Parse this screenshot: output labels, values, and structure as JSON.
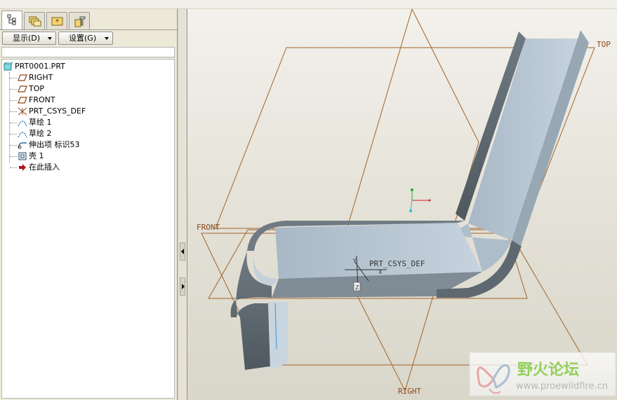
{
  "tabs": [
    {
      "icon": "model-tree-icon",
      "active": true
    },
    {
      "icon": "folder-browser-icon",
      "active": false
    },
    {
      "icon": "favorites-icon",
      "active": false
    },
    {
      "icon": "tools-icon",
      "active": false
    }
  ],
  "toolbar": {
    "show_label": "显示(D)",
    "settings_label": "设置(G)"
  },
  "tree": {
    "root": "PRT0001.PRT",
    "items": [
      {
        "label": "RIGHT",
        "icon": "datum-plane-icon"
      },
      {
        "label": "TOP",
        "icon": "datum-plane-icon"
      },
      {
        "label": "FRONT",
        "icon": "datum-plane-icon"
      },
      {
        "label": "PRT_CSYS_DEF",
        "icon": "coordinate-system-icon"
      },
      {
        "label": "草绘 1",
        "icon": "sketch-icon"
      },
      {
        "label": "草绘 2",
        "icon": "sketch-icon"
      },
      {
        "label": "伸出项 标识53",
        "icon": "sweep-icon"
      },
      {
        "label": "壳 1",
        "icon": "shell-icon"
      },
      {
        "label": "在此插入",
        "icon": "insert-here-arrow-icon"
      }
    ]
  },
  "viewport": {
    "plane_labels": {
      "top": "TOP",
      "front": "FRONT",
      "right": "RIGHT"
    },
    "csys_label": "PRT_CSYS_DEF",
    "csys_axes": {
      "x": "X",
      "y": "Y",
      "z": "Z"
    },
    "watermark": {
      "title": "野火论坛",
      "url": "www.proewildfire.cn"
    }
  },
  "colors": {
    "datum": "#a0642a",
    "part": "#b3c2cf",
    "part_dark": "#5d666d",
    "background": "#e2dfd4"
  }
}
